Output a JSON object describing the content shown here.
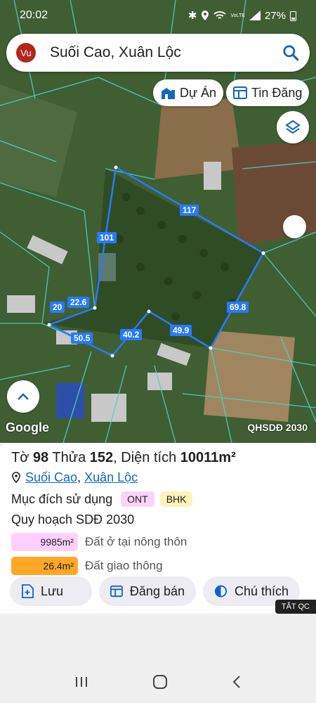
{
  "status_bar": {
    "time": "20:02",
    "battery": "27%",
    "network": "VoLTE"
  },
  "search": {
    "avatar_initials": "Vu",
    "query": "Suối Cao, Xuân Lộc"
  },
  "chips": [
    {
      "label": "Dự Án",
      "icon": "building-icon"
    },
    {
      "label": "Tin Đăng",
      "icon": "listing-icon"
    }
  ],
  "map": {
    "attribution": "Google",
    "layer_name": "QHSDĐ 2030",
    "edge_labels": [
      "117",
      "101",
      "22.6",
      "20",
      "50.5",
      "40.2",
      "49.9",
      "69.8"
    ],
    "colors": {
      "parcel_outline": "#2979ff",
      "grid_lines": "#4fd1c5"
    }
  },
  "panel": {
    "title": {
      "sheet_label": "Tờ",
      "sheet_no": "98",
      "parcel_label": "Thửa",
      "parcel_no": "152",
      "area_label": "Diện tích",
      "area_value": "10011m²"
    },
    "location": {
      "commune": "Suối Cao",
      "district": "Xuân Lộc",
      "separator": ","
    },
    "purpose_label": "Mục đích sử dụng",
    "purposes": [
      {
        "code": "ONT",
        "color": "#f8d4f8"
      },
      {
        "code": "BHK",
        "color": "#fff3b8"
      }
    ],
    "plan_label": "Quy hoạch SDĐ 2030",
    "legend": [
      {
        "area": "9985m²",
        "name": "Đất ở tại nông thôn",
        "color": "#ffd0ff",
        "fill": 1.0
      },
      {
        "area": "26.4m²",
        "name": "Đất giao thông",
        "color": "#ffa726",
        "fill": 1.0
      }
    ],
    "actions": [
      {
        "label": "Lưu",
        "icon": "save-icon"
      },
      {
        "label": "Đăng bán",
        "icon": "post-icon"
      },
      {
        "label": "Chú thích",
        "icon": "legend-icon"
      }
    ],
    "ad_label": "TẮT QC"
  }
}
